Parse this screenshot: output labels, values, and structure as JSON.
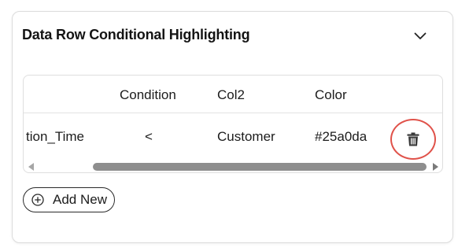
{
  "panel": {
    "title": "Data Row Conditional Highlighting",
    "collapse_icon": "chevron-down-icon"
  },
  "table": {
    "columns": [
      "",
      "Condition",
      "Col2",
      "Color",
      ""
    ],
    "rows": [
      {
        "col1": "tion_Time",
        "condition": "<",
        "col2": "Customer",
        "color": "#25a0da",
        "delete_icon": "trash-icon"
      }
    ],
    "scroll_position": "scrolled-right"
  },
  "add_new": {
    "label": "Add New",
    "icon": "plus-circle-icon"
  },
  "colors": {
    "delete_highlight": "#e0524a",
    "scroll_thumb": "#8e8e8e",
    "border": "#dcdcdc"
  }
}
